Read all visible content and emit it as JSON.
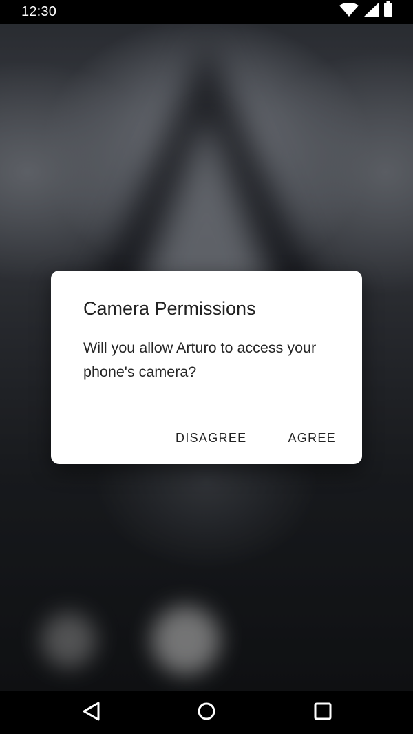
{
  "status_bar": {
    "time": "12:30",
    "icons": [
      "wifi-icon",
      "cellular-signal-icon",
      "battery-icon"
    ]
  },
  "dialog": {
    "title": "Camera Permissions",
    "message": "Will you allow Arturo to access your phone's camera?",
    "buttons": {
      "negative": "DISAGREE",
      "positive": "AGREE"
    }
  },
  "navigation_bar": {
    "icons": [
      "back-icon",
      "home-icon",
      "recents-icon"
    ]
  },
  "colors": {
    "dialog_background": "#ffffff",
    "dialog_text": "#222222",
    "system_bars": "#000000"
  }
}
